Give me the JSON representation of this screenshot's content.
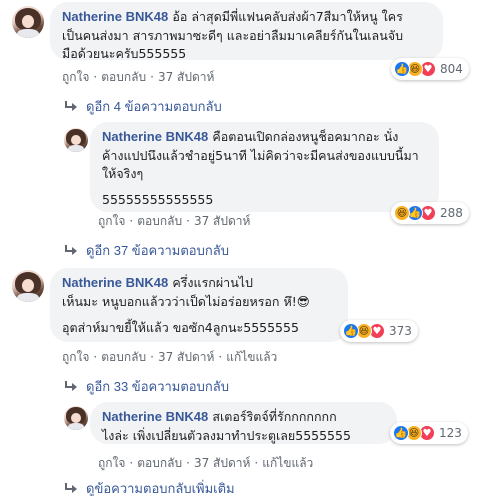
{
  "comments": [
    {
      "author": "Natherine BNK48",
      "lines": [
        "อ้อ ล่าสุดมีพี่แฟนคลับส่งผ้า7สีมาให้หนู ใคร",
        "เป็นคนส่งมา สารภาพมาซะดีๆ และอย่าลืมมาเคลียร์กันในเลนจับ",
        "มือด้วยนะครับ555555"
      ],
      "actions": {
        "like": "ถูกใจ",
        "reply": "ตอบกลับ",
        "time": "37 สัปดาห์"
      },
      "reactions": {
        "icons": [
          "like-icon",
          "haha-icon",
          "love-icon"
        ],
        "count": "804"
      },
      "more_replies": "ดูอีก 4 ข้อความตอบกลับ"
    },
    {
      "author": "Natherine BNK48",
      "lines": [
        "คือตอนเปิดกล่องหนูช็อคมากอะ นั่ง",
        "ค้างแปปนึงแล้วชำอยู่5นาที ไม่คิดว่าจะมีคนส่งของแบบนี้มา",
        "ให้จริงๆ",
        "",
        "55555555555555"
      ],
      "actions": {
        "like": "ถูกใจ",
        "reply": "ตอบกลับ",
        "time": "37 สัปดาห์"
      },
      "reactions": {
        "icons": [
          "haha-icon",
          "like-icon",
          "love-icon"
        ],
        "count": "288"
      },
      "more_replies": "ดูอีก 37 ข้อความตอบกลับ"
    },
    {
      "author": "Natherine BNK48",
      "lines": [
        "ครึ่งแรกผ่านไป",
        "เห็นมะ หนูบอกแล้ววว่าเป็ดไม่อร่อยหรอก หึ!😎",
        "",
        "อุตส่าห์มาขยี้ให้แล้ว ขอซัก4ลูกนะ5555555"
      ],
      "actions": {
        "like": "ถูกใจ",
        "reply": "ตอบกลับ",
        "time": "37 สัปดาห์",
        "edited": "แก้ไขแล้ว"
      },
      "reactions": {
        "icons": [
          "like-icon",
          "haha-icon",
          "love-icon"
        ],
        "count": "373"
      },
      "more_replies": "ดูอีก 33 ข้อความตอบกลับ"
    },
    {
      "author": "Natherine BNK48",
      "lines": [
        "สเตอร์ริตจ์ที่รักกกกกกก",
        "ไงล่ะ เพิ่งเปลี่ยนตัวลงมาทำประตูเลย5555555"
      ],
      "actions": {
        "like": "ถูกใจ",
        "reply": "ตอบกลับ",
        "time": "37 สัปดาห์",
        "edited": "แก้ไขแล้ว"
      },
      "reactions": {
        "icons": [
          "like-icon",
          "haha-icon",
          "love-icon"
        ],
        "count": "123"
      },
      "more_replies": "ดูข้อความตอบกลับเพิ่มเติม"
    }
  ],
  "colors": {
    "link": "#385898",
    "bubble": "#f2f3f5",
    "like": "#1877f2",
    "haha": "#f7b125",
    "love": "#f33e58",
    "meta": "#606770"
  }
}
